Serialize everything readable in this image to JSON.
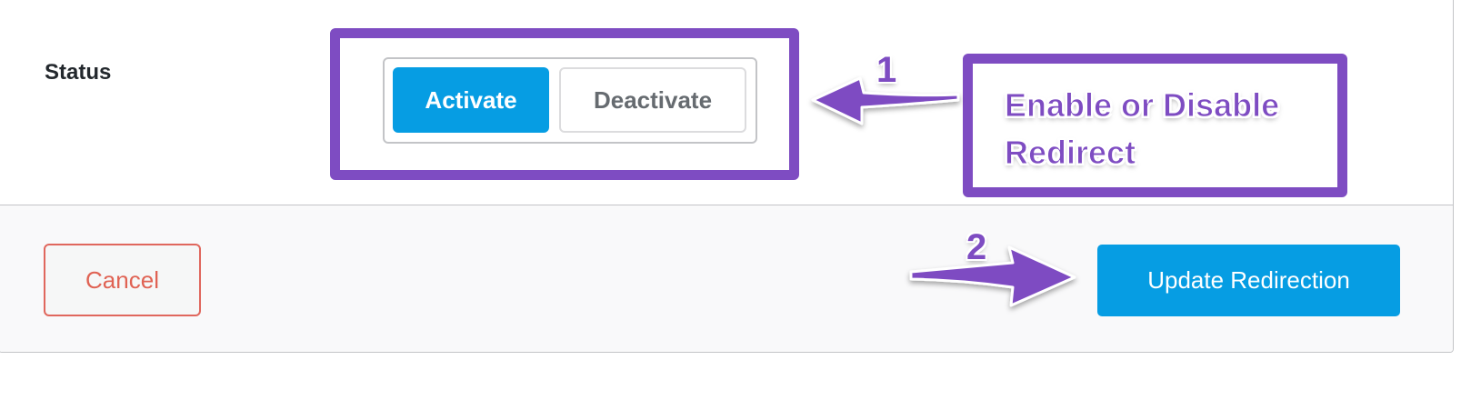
{
  "form": {
    "status_label": "Status",
    "activate_label": "Activate",
    "deactivate_label": "Deactivate",
    "selected": "Activate"
  },
  "footer": {
    "cancel_label": "Cancel",
    "update_label": "Update Redirection"
  },
  "annotations": {
    "step_1": "1",
    "step_2": "2",
    "callout_line_1": "Enable or Disable",
    "callout_line_2": "Redirect",
    "color": "#7e4cc2"
  },
  "colors": {
    "primary_button": "#069de3",
    "cancel_text": "#e06354",
    "annotation": "#7e4cc2"
  }
}
